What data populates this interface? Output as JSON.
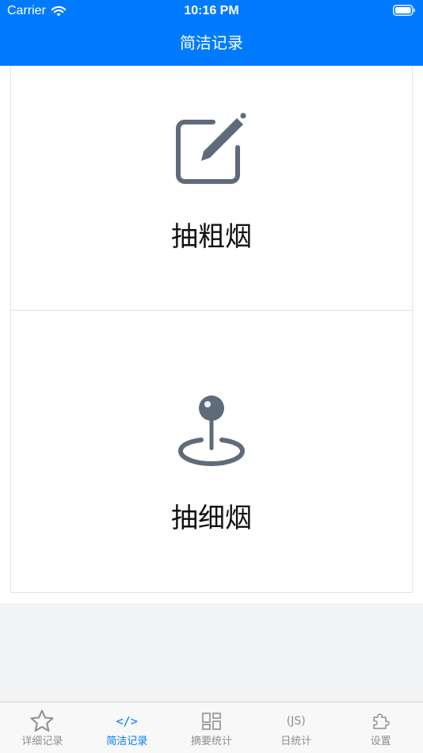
{
  "status_bar": {
    "carrier": "Carrier",
    "time": "10:16 PM"
  },
  "nav": {
    "title": "简洁记录"
  },
  "cards": [
    {
      "label": "抽粗烟",
      "icon": "edit-icon"
    },
    {
      "label": "抽细烟",
      "icon": "map-pin-icon"
    }
  ],
  "tabs": [
    {
      "label": "详细记录",
      "icon": "star-icon",
      "active": false
    },
    {
      "label": "简洁记录",
      "icon": "code-icon",
      "glyph": "</>",
      "active": true
    },
    {
      "label": "摘要统计",
      "icon": "grid-icon",
      "active": false
    },
    {
      "label": "日统计",
      "icon": "js-icon",
      "glyph": "(JS)",
      "active": false
    },
    {
      "label": "设置",
      "icon": "puzzle-icon",
      "active": false
    }
  ],
  "colors": {
    "accent": "#007aff",
    "icon_gray": "#5f6b7a",
    "tab_inactive": "#8e8e93"
  }
}
